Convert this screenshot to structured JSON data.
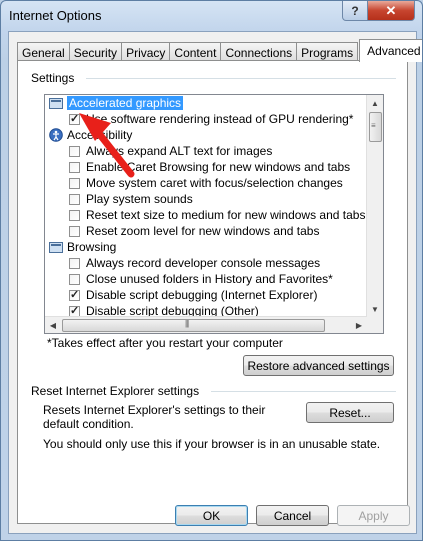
{
  "window": {
    "title": "Internet Options",
    "help_label": "?",
    "close_label": "✕"
  },
  "tabs": [
    {
      "label": "General"
    },
    {
      "label": "Security"
    },
    {
      "label": "Privacy"
    },
    {
      "label": "Content"
    },
    {
      "label": "Connections"
    },
    {
      "label": "Programs"
    },
    {
      "label": "Advanced"
    }
  ],
  "active_tab": "Advanced",
  "settings": {
    "group_label": "Settings",
    "items": [
      {
        "type": "category",
        "label": "Accelerated graphics",
        "icon": "folder-icon",
        "selected": true
      },
      {
        "type": "checkbox",
        "label": "Use software rendering instead of GPU rendering*",
        "checked": true
      },
      {
        "type": "category",
        "label": "Accessibility",
        "icon": "accessibility-icon"
      },
      {
        "type": "checkbox",
        "label": "Always expand ALT text for images",
        "checked": false
      },
      {
        "type": "checkbox",
        "label": "Enable Caret Browsing for new windows and tabs",
        "checked": false
      },
      {
        "type": "checkbox",
        "label": "Move system caret with focus/selection changes",
        "checked": false
      },
      {
        "type": "checkbox",
        "label": "Play system sounds",
        "checked": false
      },
      {
        "type": "checkbox",
        "label": "Reset text size to medium for new windows and tabs",
        "checked": false
      },
      {
        "type": "checkbox",
        "label": "Reset zoom level for new windows and tabs",
        "checked": false
      },
      {
        "type": "category",
        "label": "Browsing",
        "icon": "folder-icon"
      },
      {
        "type": "checkbox",
        "label": "Always record developer console messages",
        "checked": false
      },
      {
        "type": "checkbox",
        "label": "Close unused folders in History and Favorites*",
        "checked": false
      },
      {
        "type": "checkbox",
        "label": "Disable script debugging (Internet Explorer)",
        "checked": true
      },
      {
        "type": "checkbox",
        "label": "Disable script debugging (Other)",
        "checked": true
      }
    ],
    "note": "*Takes effect after you restart your computer",
    "restore_button": "Restore advanced settings"
  },
  "reset": {
    "group_label": "Reset Internet Explorer settings",
    "description": "Resets Internet Explorer's settings to their default condition.",
    "button": "Reset...",
    "warning": "You should only use this if your browser is in an unusable state."
  },
  "footer": {
    "ok": "OK",
    "cancel": "Cancel",
    "apply": "Apply"
  },
  "colors": {
    "selection": "#3399ff",
    "annotation_arrow": "#e8201a"
  }
}
